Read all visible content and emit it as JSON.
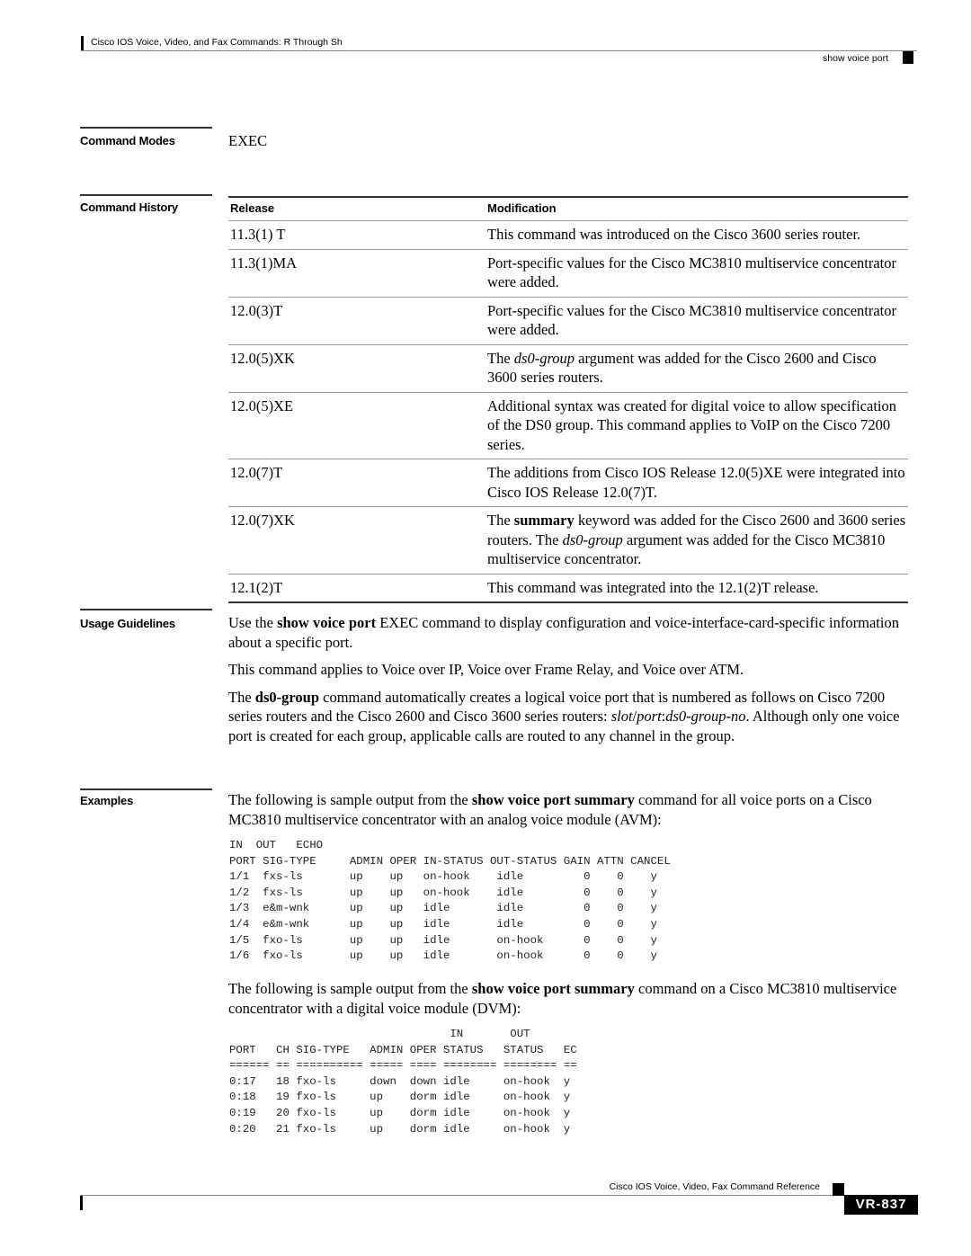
{
  "header": {
    "book_title": "Cisco IOS Voice, Video, and Fax Commands: R Through Sh",
    "section_title": "show voice port"
  },
  "command_modes": {
    "label": "Command Modes",
    "value": "EXEC"
  },
  "command_history": {
    "label": "Command History",
    "columns": [
      "Release",
      "Modification"
    ],
    "rows": [
      {
        "release": "11.3(1) T",
        "modification_html": "This command was introduced on the Cisco 3600 series router."
      },
      {
        "release": "11.3(1)MA",
        "modification_html": "Port-specific values for the Cisco MC3810 multiservice concentrator were added."
      },
      {
        "release": "12.0(3)T",
        "modification_html": "Port-specific values for the Cisco MC3810 multiservice concentrator were added."
      },
      {
        "release": "12.0(5)XK",
        "modification_html": "The <i>ds0-group</i> argument was added for the Cisco 2600 and Cisco 3600 series routers."
      },
      {
        "release": "12.0(5)XE",
        "modification_html": "Additional syntax was created for digital voice to allow specification of the DS0 group. This command applies to VoIP on the Cisco 7200 series."
      },
      {
        "release": "12.0(7)T",
        "modification_html": "The additions from Cisco IOS Release 12.0(5)XE were integrated into Cisco IOS Release 12.0(7)T."
      },
      {
        "release": "12.0(7)XK",
        "modification_html": "The <b>summary</b> keyword was added for the Cisco 2600 and 3600 series routers. The <i>ds0-group</i> argument was added for the Cisco MC3810 multiservice concentrator."
      },
      {
        "release": "12.1(2)T",
        "modification_html": "This command was integrated into the 12.1(2)T release."
      }
    ]
  },
  "usage_guidelines": {
    "label": "Usage Guidelines",
    "paragraphs_html": [
      "Use the <b>show voice port</b> EXEC command to display configuration and voice-interface-card-specific information about a specific port.",
      "This command applies to Voice over IP, Voice over Frame Relay, and Voice over ATM.",
      "The <b>ds0-group</b> command automatically creates a logical voice port that is numbered as follows on Cisco 7200 series routers and the Cisco 2600 and Cisco 3600 series routers: <i>slot</i>/<i>port</i>:<i>ds0-group-no</i>. Although only one voice port is created for each group, applicable calls are routed to any channel in the group."
    ]
  },
  "examples": {
    "label": "Examples",
    "intro1_html": "The following is sample output from the <b>show voice port summary</b> command for all voice ports on a Cisco MC3810 multiservice concentrator with an analog voice module (AVM):",
    "output1": "IN  OUT   ECHO\nPORT SIG-TYPE     ADMIN OPER IN-STATUS OUT-STATUS GAIN ATTN CANCEL\n1/1  fxs-ls       up    up   on-hook    idle         0    0    y\n1/2  fxs-ls       up    up   on-hook    idle         0    0    y\n1/3  e&m-wnk      up    up   idle       idle         0    0    y\n1/4  e&m-wnk      up    up   idle       idle         0    0    y\n1/5  fxo-ls       up    up   idle       on-hook      0    0    y\n1/6  fxo-ls       up    up   idle       on-hook      0    0    y",
    "intro2_html": "The following is sample output from the <b>show voice port summary</b> command on a Cisco MC3810 multiservice concentrator with a digital voice module (DVM):",
    "output2": "                                 IN       OUT\nPORT   CH SIG-TYPE   ADMIN OPER STATUS   STATUS   EC\n====== == ========== ===== ==== ======== ======== ==\n0:17   18 fxo-ls     down  down idle     on-hook  y\n0:18   19 fxo-ls     up    dorm idle     on-hook  y\n0:19   20 fxo-ls     up    dorm idle     on-hook  y\n0:20   21 fxo-ls     up    dorm idle     on-hook  y"
  },
  "footer": {
    "book_title": "Cisco IOS Voice, Video, Fax Command Reference",
    "page_number": "VR-837"
  }
}
